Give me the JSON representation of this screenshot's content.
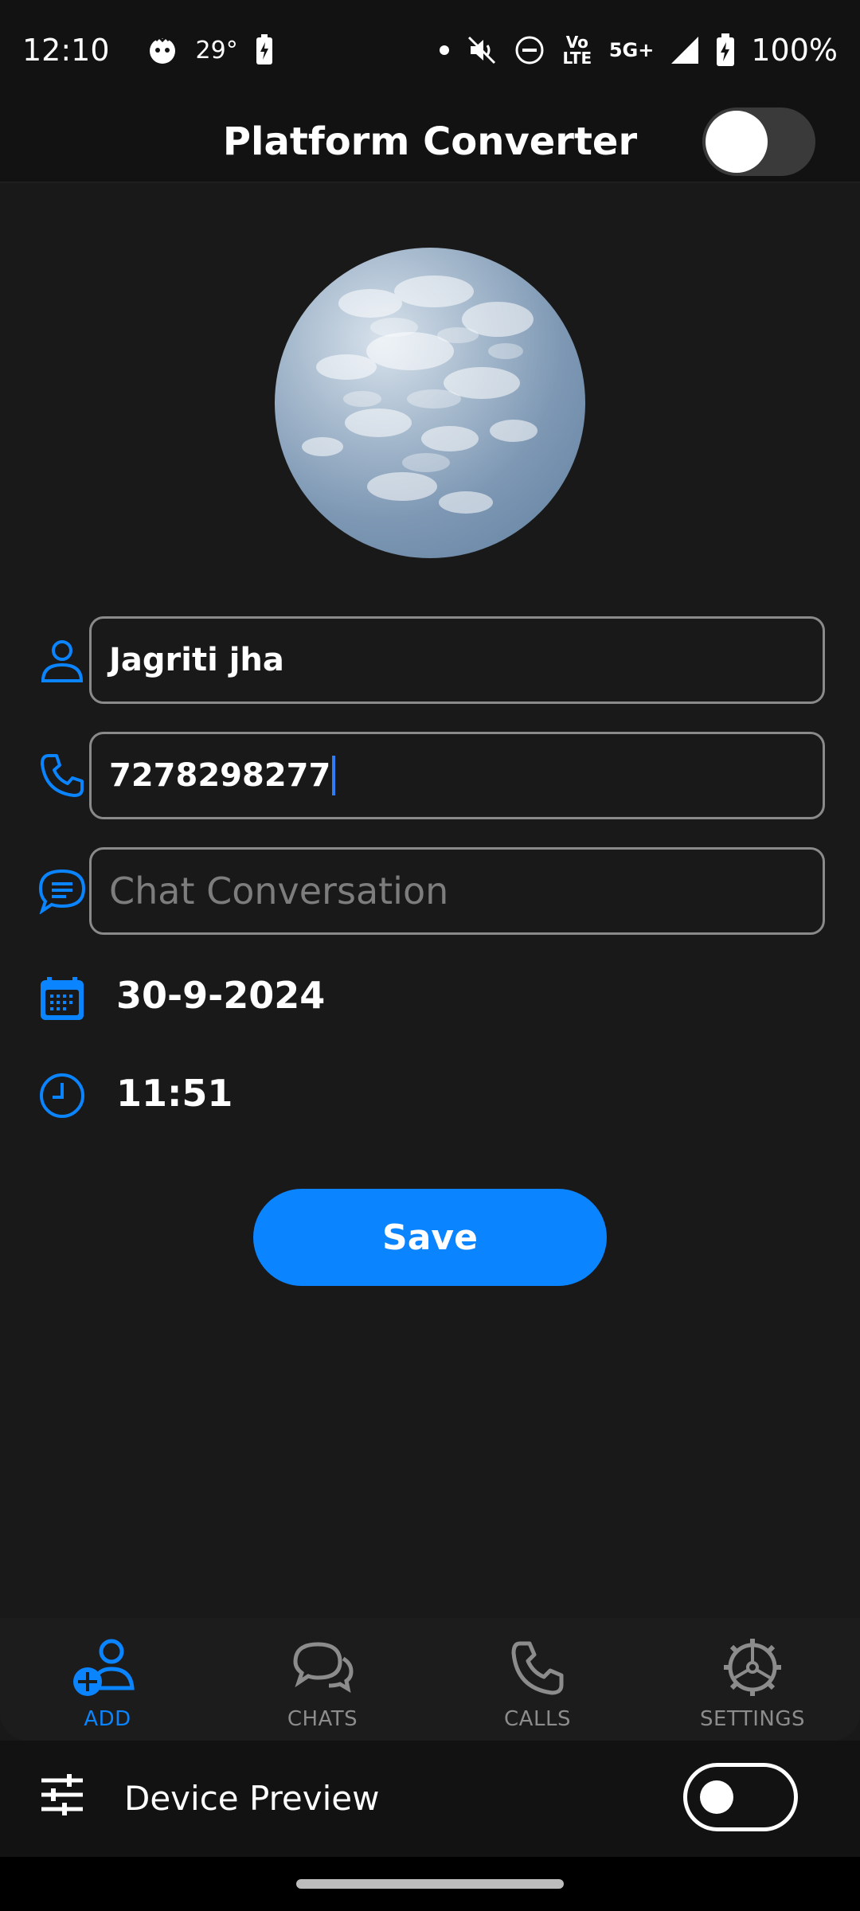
{
  "status_bar": {
    "time": "12:10",
    "temperature": "29°",
    "network_volte": "Vo LTE",
    "network_5g": "5G+",
    "battery_percent": "100%"
  },
  "app_bar": {
    "title": "Platform Converter",
    "theme_toggle_on": false
  },
  "form": {
    "name_value": "Jagriti jha",
    "phone_value": "7278298277",
    "chat_placeholder": "Chat Conversation",
    "date_value": "30-9-2024",
    "time_value": "11:51",
    "save_label": "Save"
  },
  "bottom_nav": {
    "items": [
      {
        "label": "ADD",
        "icon": "add-person-icon",
        "active": true
      },
      {
        "label": "CHATS",
        "icon": "chat-bubbles-icon",
        "active": false
      },
      {
        "label": "CALLS",
        "icon": "phone-icon",
        "active": false
      },
      {
        "label": "SETTINGS",
        "icon": "settings-icon",
        "active": false
      }
    ]
  },
  "device_preview": {
    "label": "Device Preview",
    "toggle_on": false
  },
  "colors": {
    "accent": "#0a84ff",
    "background": "#191919",
    "bar_background": "#121212",
    "inactive": "#8c8c8c"
  }
}
